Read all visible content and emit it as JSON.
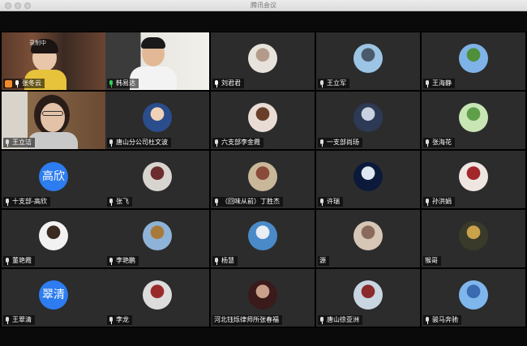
{
  "window": {
    "title": "腾讯会议"
  },
  "colors": {
    "active_border": "#2ec24a",
    "mic_active": "#35d05a",
    "avatar_blue": "#2d7cf0"
  },
  "recording_badge": "录制中",
  "participants": [
    {
      "name": "张冬云",
      "kind": "video",
      "mic": "raised"
    },
    {
      "name": "韩易达",
      "kind": "video",
      "mic": "active"
    },
    {
      "name": "刘君君",
      "kind": "photo",
      "mic": "on",
      "tone": [
        "#e8e2dc",
        "#b39a8a"
      ]
    },
    {
      "name": "王立军",
      "kind": "photo",
      "mic": "muted",
      "tone": [
        "#9cc4e4",
        "#4a5a6a"
      ]
    },
    {
      "name": "王海静",
      "kind": "photo",
      "mic": "muted",
      "tone": [
        "#7fb3e8",
        "#4f8f3a"
      ]
    },
    {
      "name": "王立洁",
      "kind": "video2",
      "mic": "muted"
    },
    {
      "name": "唐山分公司杜文波",
      "kind": "photo",
      "mic": "muted",
      "tone": [
        "#2a4d8c",
        "#f0d2b6"
      ]
    },
    {
      "name": "六支部李金霞",
      "kind": "photo",
      "mic": "muted",
      "tone": [
        "#e8dcd4",
        "#6a3f2a"
      ]
    },
    {
      "name": "一支部尚玚",
      "kind": "photo",
      "mic": "muted",
      "tone": [
        "#2d3a55",
        "#c9d2e0"
      ]
    },
    {
      "name": "张海花",
      "kind": "photo",
      "mic": "muted",
      "tone": [
        "#c8e6b4",
        "#5f9f4a"
      ]
    },
    {
      "name": "十支部-高欣",
      "kind": "text",
      "mic": "muted",
      "initials": "高欣"
    },
    {
      "name": "张飞",
      "kind": "photo",
      "mic": "muted",
      "tone": [
        "#d8d4d0",
        "#6b2d2d"
      ]
    },
    {
      "name": "（回味从前）丁胜杰",
      "kind": "photo",
      "mic": "muted",
      "tone": [
        "#c9b79a",
        "#8a4a3a"
      ]
    },
    {
      "name": "许瑞",
      "kind": "photo",
      "mic": "muted",
      "tone": [
        "#0b1a3a",
        "#dfe7f2"
      ]
    },
    {
      "name": "孙洪娟",
      "kind": "photo",
      "mic": "muted",
      "tone": [
        "#efe6e2",
        "#a3262a"
      ]
    },
    {
      "name": "董艳霞",
      "kind": "photo",
      "mic": "muted",
      "tone": [
        "#f2f2f2",
        "#3a2a22"
      ]
    },
    {
      "name": "李艳鹏",
      "kind": "photo",
      "mic": "muted",
      "tone": [
        "#8fb3d8",
        "#a87a3a"
      ]
    },
    {
      "name": "杨慧",
      "kind": "photo",
      "mic": "muted",
      "tone": [
        "#4a8ac9",
        "#e8eef4"
      ]
    },
    {
      "name": "源",
      "kind": "photo",
      "mic": "none",
      "tone": [
        "#d6c6b6",
        "#8a6a5a"
      ]
    },
    {
      "name": "猴哥",
      "kind": "photo",
      "mic": "none",
      "tone": [
        "#3a3a2a",
        "#c9a24a"
      ]
    },
    {
      "name": "王翠清",
      "kind": "text",
      "mic": "muted",
      "initials": "翠清"
    },
    {
      "name": "李龙",
      "kind": "photo",
      "mic": "muted",
      "tone": [
        "#dcdcdc",
        "#9a2a2a"
      ]
    },
    {
      "name": "河北钰烁律师所张春福",
      "kind": "photo",
      "mic": "none",
      "tone": [
        "#3a1a1a",
        "#c9a08a"
      ]
    },
    {
      "name": "唐山徐亚洲",
      "kind": "photo",
      "mic": "muted",
      "tone": [
        "#c9d6e2",
        "#8a2a2a"
      ]
    },
    {
      "name": "骏马奔驰",
      "kind": "photo",
      "mic": "muted",
      "tone": [
        "#7fb6ec",
        "#3a6ab0"
      ]
    }
  ]
}
